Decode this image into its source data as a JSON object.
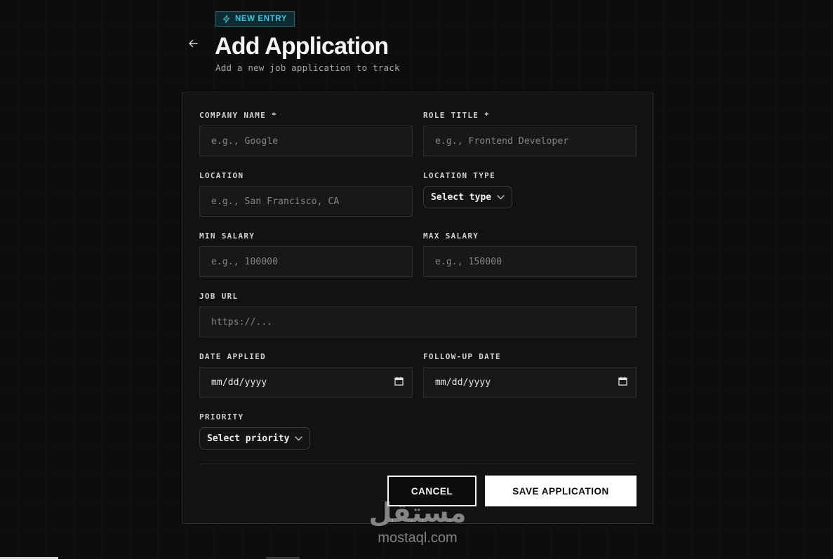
{
  "header": {
    "badge": "NEW ENTRY",
    "title": "Add Application",
    "subtitle": "Add a new job application to track"
  },
  "form": {
    "company_name": {
      "label": "COMPANY NAME *",
      "placeholder": "e.g., Google"
    },
    "role_title": {
      "label": "ROLE TITLE *",
      "placeholder": "e.g., Frontend Developer"
    },
    "location": {
      "label": "LOCATION",
      "placeholder": "e.g., San Francisco, CA"
    },
    "location_type": {
      "label": "LOCATION TYPE",
      "value": "Select type"
    },
    "min_salary": {
      "label": "MIN SALARY",
      "placeholder": "e.g., 100000"
    },
    "max_salary": {
      "label": "MAX SALARY",
      "placeholder": "e.g., 150000"
    },
    "job_url": {
      "label": "JOB URL",
      "placeholder": "https://..."
    },
    "date_applied": {
      "label": "DATE APPLIED",
      "value": "mm/dd/yyyy"
    },
    "follow_up_date": {
      "label": "FOLLOW-UP DATE",
      "value": "mm/dd/yyyy"
    },
    "priority": {
      "label": "PRIORITY",
      "value": "Select priority"
    }
  },
  "actions": {
    "cancel": "CANCEL",
    "save": "SAVE APPLICATION"
  },
  "watermark": {
    "arabic": "مستقل",
    "latin": "mostaql.com"
  },
  "icons": {
    "back": "arrow-left-icon",
    "badge": "lightning-icon",
    "select": "chevron-down-icon",
    "date": "calendar-icon"
  },
  "colors": {
    "background": "#0d0d0d",
    "accent": "#3fc3da",
    "card": "#121212",
    "primary_button": "#ffffff"
  }
}
